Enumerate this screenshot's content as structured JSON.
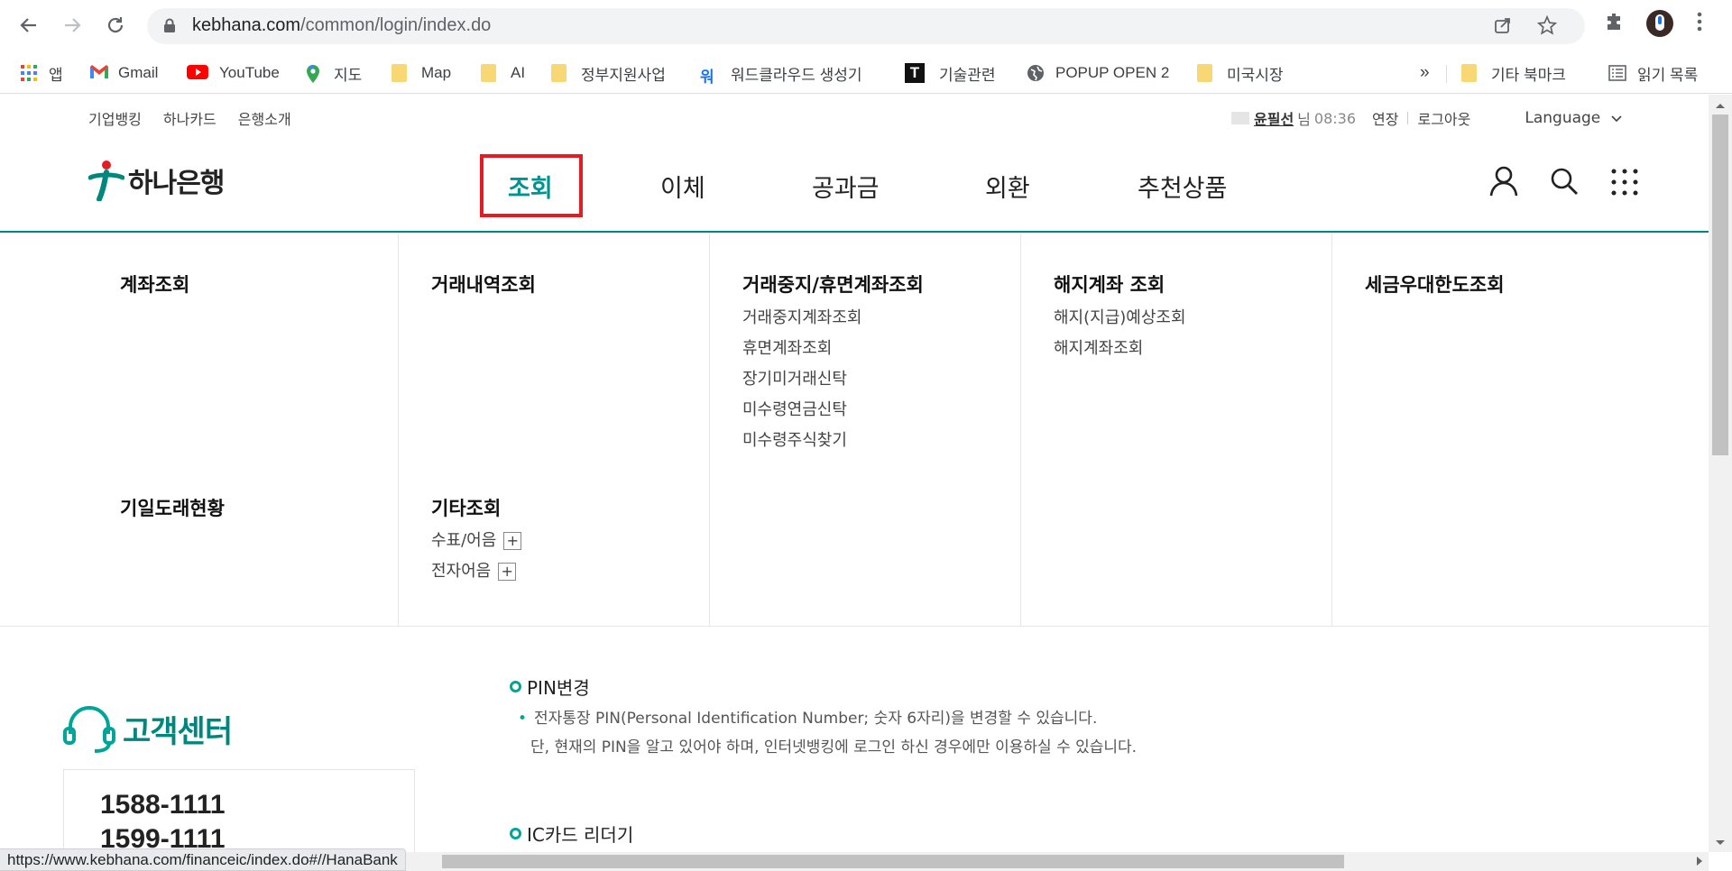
{
  "browser": {
    "url_host": "kebhana.com",
    "url_path": "/common/login/index.do",
    "bookmarks": [
      {
        "label": "앱",
        "icon": "apps-grid-icon"
      },
      {
        "label": "Gmail",
        "icon": "gmail-icon"
      },
      {
        "label": "YouTube",
        "icon": "youtube-icon"
      },
      {
        "label": "지도",
        "icon": "maps-pin-icon"
      },
      {
        "label": "Map",
        "icon": "folder-icon"
      },
      {
        "label": "AI",
        "icon": "folder-icon"
      },
      {
        "label": "정부지원사업",
        "icon": "folder-icon"
      },
      {
        "label": "워드클라우드 생성기",
        "icon": "word-icon"
      },
      {
        "label": "기술관련",
        "icon": "t-icon"
      },
      {
        "label": "POPUP OPEN 2",
        "icon": "globe-icon"
      },
      {
        "label": "미국시장",
        "icon": "folder-icon"
      }
    ],
    "overflow": "»",
    "other_bookmarks": "기타 북마크",
    "reading_list": "읽기 목록",
    "status_url": "https://www.kebhana.com/financeic/index.do#//HanaBank"
  },
  "util": {
    "left": [
      "기업뱅킹",
      "하나카드",
      "은행소개"
    ],
    "user_name": "윤필선",
    "user_suffix": "님",
    "time": "08:36",
    "extend": "연장",
    "logout": "로그아웃",
    "language": "Language"
  },
  "logo": {
    "text": "하나은행"
  },
  "gnb": [
    "조회",
    "이체",
    "공과금",
    "외환",
    "추천상품"
  ],
  "mega": {
    "col1": {
      "title": "계좌조회",
      "title2": "기일도래현황"
    },
    "col2": {
      "title": "거래내역조회",
      "title2": "기타조회",
      "subs2": [
        "수표/어음",
        "전자어음"
      ]
    },
    "col3": {
      "title": "거래중지/휴면계좌조회",
      "subs": [
        "거래중지계좌조회",
        "휴면계좌조회",
        "장기미거래신탁",
        "미수령연금신탁",
        "미수령주식찾기"
      ]
    },
    "col4": {
      "title": "해지계좌 조회",
      "subs": [
        "해지(지급)예상조회",
        "해지계좌조회"
      ]
    },
    "col5": {
      "title": "세금우대한도조회"
    }
  },
  "cs": {
    "title": "고객센터",
    "numbers": [
      "1588-1111",
      "1599-1111"
    ]
  },
  "sections": {
    "pin_title": "PIN변경",
    "pin_desc1": "전자통장 PIN(Personal Identification Number; 숫자 6자리)을 변경할 수 있습니다.",
    "pin_desc2": "단, 현재의 PIN을 알고 있어야 하며, 인터넷뱅킹에 로그인 하신 경우에만 이용하실 수 있습니다.",
    "ic_title": "IC카드 리더기"
  },
  "colors": {
    "brand": "#00877d",
    "highlight_box": "#e31b23",
    "active_menu": "#009490"
  }
}
